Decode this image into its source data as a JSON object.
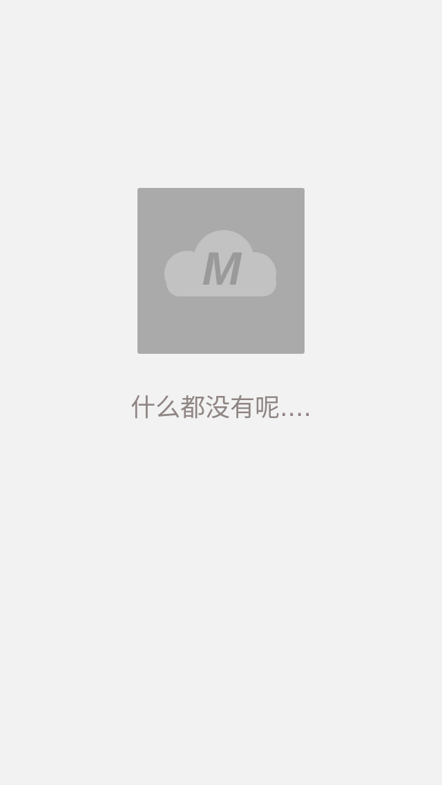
{
  "empty_state": {
    "icon": "cloud-m-icon",
    "icon_letter": "M",
    "message": "什么都没有呢....",
    "colors": {
      "background": "#f2f2f2",
      "box": "#aaaaaa",
      "cloud": "#c2c2c2",
      "letter": "#9a9a9a",
      "text": "#8f8583"
    }
  }
}
